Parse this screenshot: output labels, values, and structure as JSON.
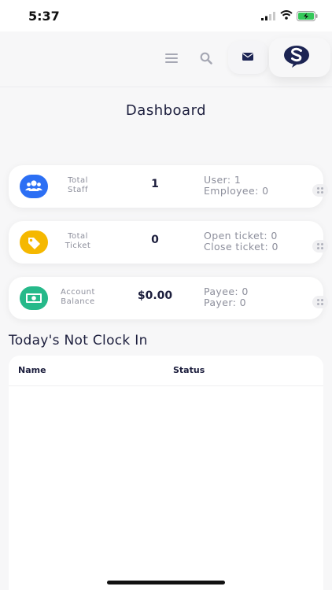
{
  "status_bar": {
    "time": "5:37"
  },
  "header": {
    "icons": [
      "menu-icon",
      "search-icon",
      "mail-icon",
      "brand-logo-icon"
    ]
  },
  "page_title": "Dashboard",
  "cards": [
    {
      "icon": "users-icon",
      "icon_color": "#2c6ff4",
      "label_line1": "Total",
      "label_line2": "Staff",
      "value": "1",
      "info_line1": "User: 1",
      "info_line2": "Employee: 0"
    },
    {
      "icon": "tag-icon",
      "icon_color": "#f5b800",
      "label_line1": "Total",
      "label_line2": "Ticket",
      "value": "0",
      "info_line1": "Open ticket: 0",
      "info_line2": "Close ticket: 0"
    },
    {
      "icon": "cash-icon",
      "icon_color": "#26b98a",
      "label_line1": "Account",
      "label_line2": "Balance",
      "value": "$0.00",
      "info_line1": "Payee: 0",
      "info_line2": "Payer: 0"
    }
  ],
  "clock_in": {
    "title": "Today's Not Clock In",
    "columns": [
      "Name",
      "Status"
    ],
    "rows": []
  },
  "colors": {
    "brand_navy": "#1c2453",
    "background": "#f7f7f8"
  }
}
